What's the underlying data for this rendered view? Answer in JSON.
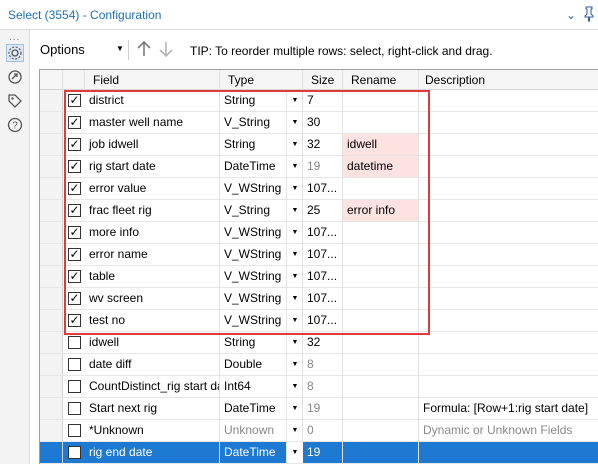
{
  "window": {
    "title": "Select (3554) - Configuration"
  },
  "toolbar": {
    "options_label": "Options",
    "tip": "TIP: To reorder multiple rows: select, right-click and drag."
  },
  "rail": {
    "dots": "..."
  },
  "columns": {
    "field": "Field",
    "type": "Type",
    "size": "Size",
    "rename": "Rename",
    "description": "Description"
  },
  "rows": [
    {
      "checked": true,
      "field": "district",
      "type": "String",
      "size": "7",
      "rename": "",
      "description": ""
    },
    {
      "checked": true,
      "field": "master well name",
      "type": "V_String",
      "size": "30",
      "rename": "",
      "description": ""
    },
    {
      "checked": true,
      "field": "job idwell",
      "type": "String",
      "size": "32",
      "rename": "idwell",
      "description": ""
    },
    {
      "checked": true,
      "field": "rig start date",
      "type": "DateTime",
      "size": "19",
      "rename": "datetime",
      "description": ""
    },
    {
      "checked": true,
      "field": "error value",
      "type": "V_WString",
      "size": "107...",
      "rename": "",
      "description": ""
    },
    {
      "checked": true,
      "field": "frac fleet rig",
      "type": "V_String",
      "size": "25",
      "rename": "error info",
      "description": ""
    },
    {
      "checked": true,
      "field": "more info",
      "type": "V_WString",
      "size": "107...",
      "rename": "",
      "description": ""
    },
    {
      "checked": true,
      "field": "error name",
      "type": "V_WString",
      "size": "107...",
      "rename": "",
      "description": ""
    },
    {
      "checked": true,
      "field": "table",
      "type": "V_WString",
      "size": "107...",
      "rename": "",
      "description": ""
    },
    {
      "checked": true,
      "field": "wv screen",
      "type": "V_WString",
      "size": "107...",
      "rename": "",
      "description": ""
    },
    {
      "checked": true,
      "field": "test no",
      "type": "V_WString",
      "size": "107...",
      "rename": "",
      "description": ""
    },
    {
      "checked": false,
      "field": "idwell",
      "type": "String",
      "size": "32",
      "rename": "",
      "description": ""
    },
    {
      "checked": false,
      "field": "date diff",
      "type": "Double",
      "size": "8",
      "rename": "",
      "description": ""
    },
    {
      "checked": false,
      "field": "CountDistinct_rig start date",
      "type": "Int64",
      "size": "8",
      "rename": "",
      "description": ""
    },
    {
      "checked": false,
      "field": "Start next rig",
      "type": "DateTime",
      "size": "19",
      "rename": "",
      "description": "Formula: [Row+1:rig start date]"
    },
    {
      "checked": false,
      "field": "*Unknown",
      "type": "Unknown",
      "size": "0",
      "rename": "",
      "description": "Dynamic or Unknown Fields"
    },
    {
      "checked": false,
      "field": "rig end date",
      "type": "DateTime",
      "size": "19",
      "rename": "",
      "description": ""
    }
  ],
  "colors": {
    "accent": "#1e79d3",
    "rename_highlight": "#fde2e2",
    "annotation_box": "#e03a3a",
    "title": "#1e6fb8"
  }
}
